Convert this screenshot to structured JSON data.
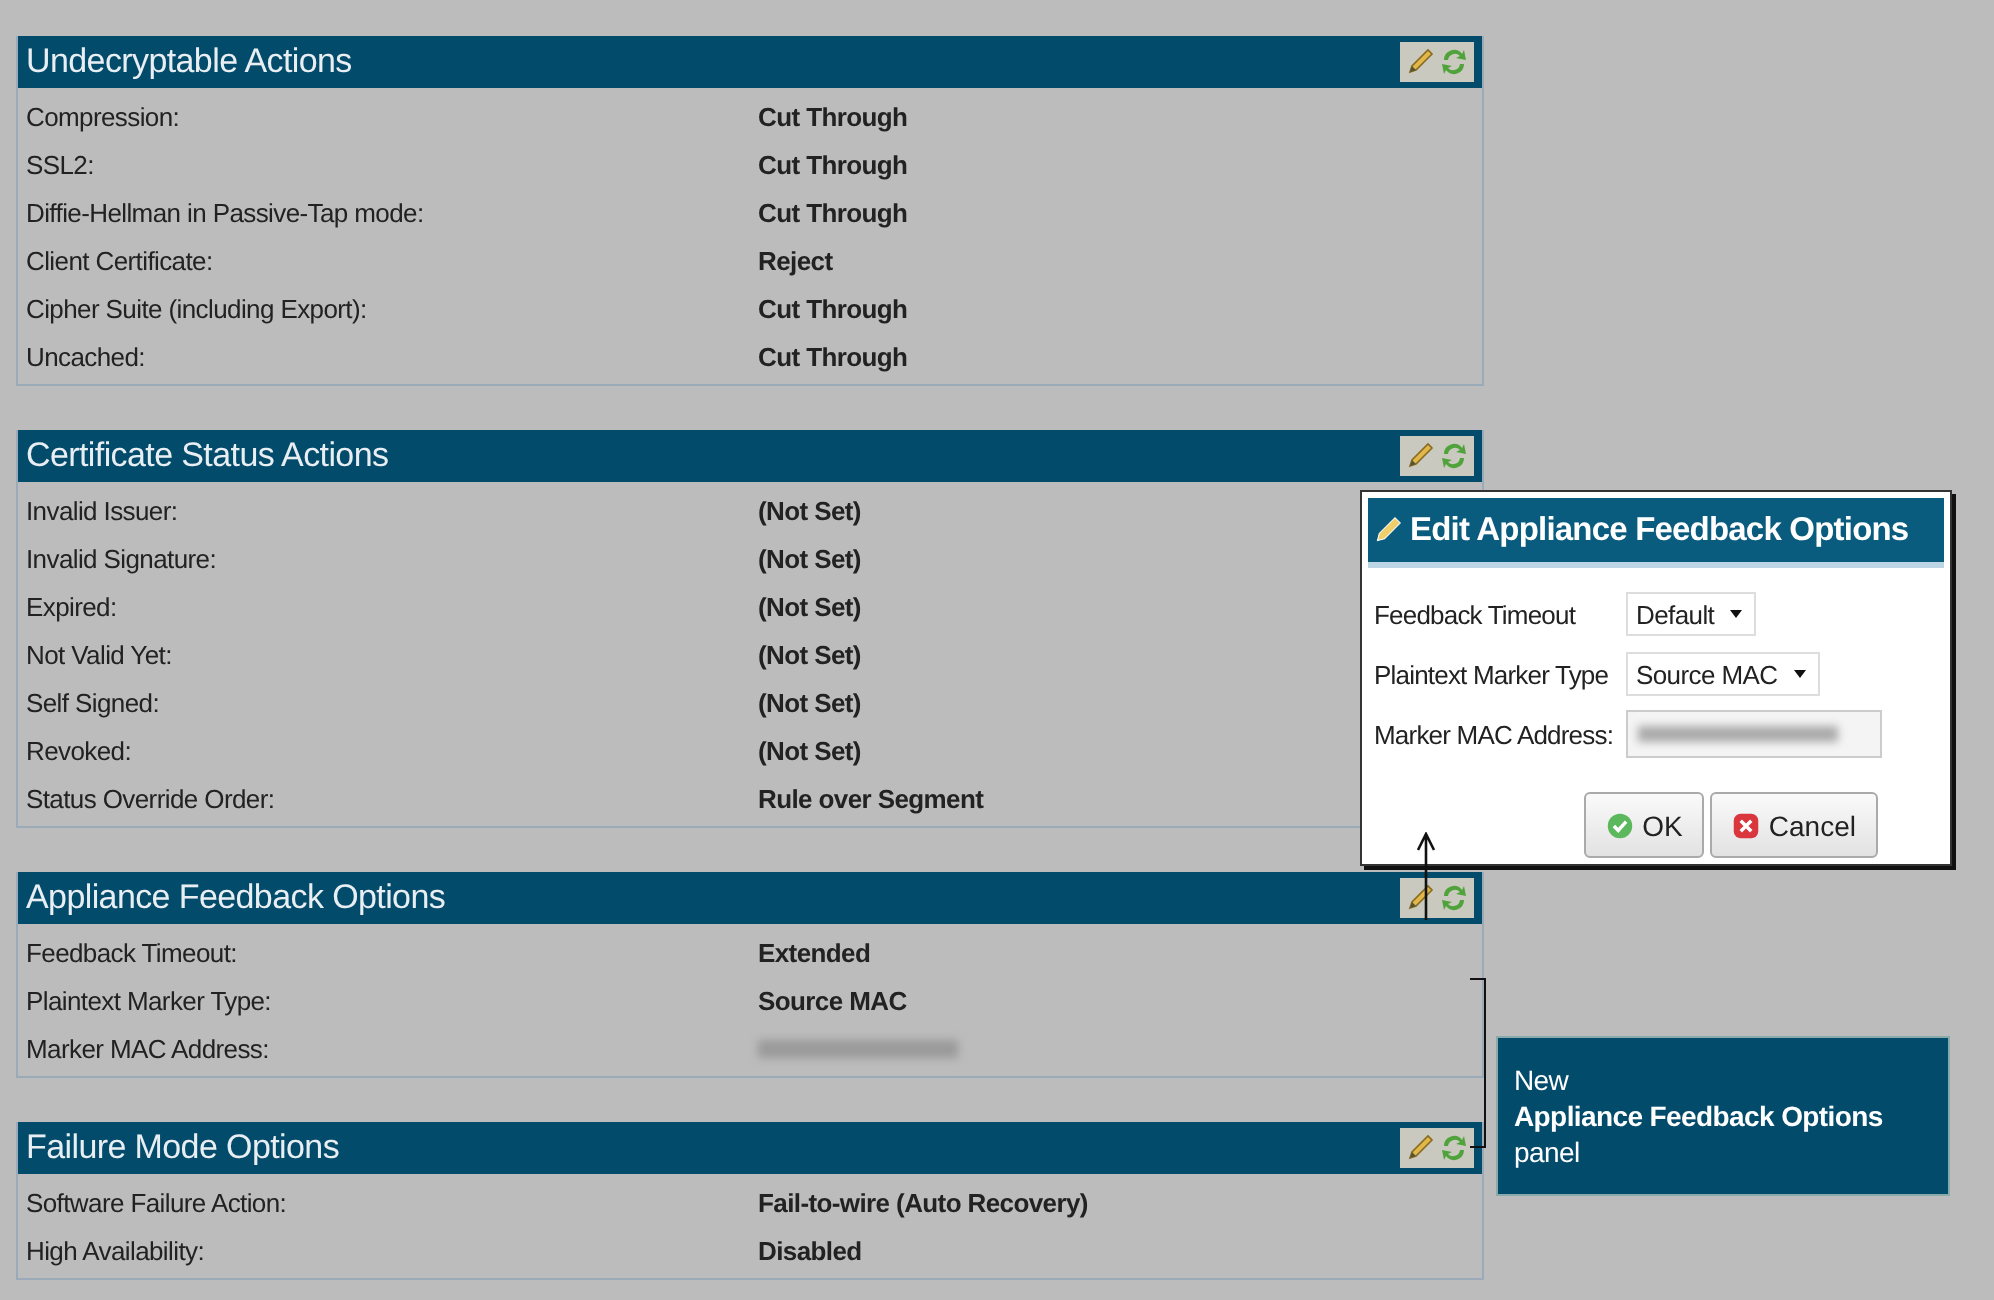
{
  "panels": [
    {
      "title": "Undecryptable Actions",
      "rows": [
        {
          "label": "Compression:",
          "value": "Cut Through"
        },
        {
          "label": "SSL2:",
          "value": "Cut Through"
        },
        {
          "label": "Diffie-Hellman in Passive-Tap mode:",
          "value": "Cut Through"
        },
        {
          "label": "Client Certificate:",
          "value": "Reject"
        },
        {
          "label": "Cipher Suite (including Export):",
          "value": "Cut Through"
        },
        {
          "label": "Uncached:",
          "value": "Cut Through"
        }
      ]
    },
    {
      "title": "Certificate Status Actions",
      "rows": [
        {
          "label": "Invalid Issuer:",
          "value": "(Not Set)"
        },
        {
          "label": "Invalid Signature:",
          "value": "(Not Set)"
        },
        {
          "label": "Expired:",
          "value": "(Not Set)"
        },
        {
          "label": "Not Valid Yet:",
          "value": "(Not Set)"
        },
        {
          "label": "Self Signed:",
          "value": "(Not Set)"
        },
        {
          "label": "Revoked:",
          "value": "(Not Set)"
        },
        {
          "label": "Status Override Order:",
          "value": "Rule over Segment"
        }
      ]
    },
    {
      "title": "Appliance Feedback Options",
      "rows": [
        {
          "label": "Feedback Timeout:",
          "value": "Extended"
        },
        {
          "label": "Plaintext Marker Type:",
          "value": "Source MAC"
        },
        {
          "label": "Marker MAC Address:",
          "kind": "redacted"
        }
      ]
    },
    {
      "title": "Failure Mode Options",
      "rows": [
        {
          "label": "Software Failure Action:",
          "value": "Fail-to-wire (Auto Recovery)"
        },
        {
          "label": "High Availability:",
          "value": "Disabled"
        }
      ]
    }
  ],
  "dialog": {
    "title": "Edit Appliance Feedback Options",
    "fields": [
      {
        "label": "Feedback Timeout",
        "kind": "select",
        "value": "Default"
      },
      {
        "label": "Plaintext Marker Type",
        "kind": "select",
        "value": "Source MAC"
      },
      {
        "label": "Marker MAC Address:",
        "kind": "redacted"
      }
    ],
    "buttons": [
      {
        "label": "OK",
        "kind": "ok"
      },
      {
        "label": "Cancel",
        "kind": "cancel"
      }
    ]
  },
  "callout": {
    "line_1": "New",
    "line_2": "Appliance Feedback Options",
    "line_3": "panel"
  }
}
